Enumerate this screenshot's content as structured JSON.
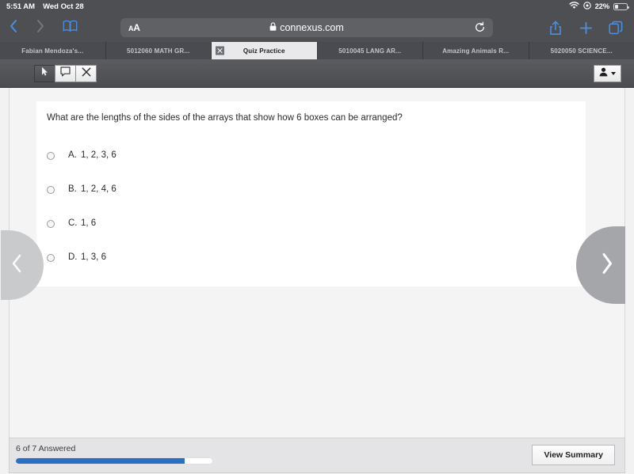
{
  "status_bar": {
    "time": "5:51 AM",
    "date": "Wed Oct 28",
    "wifi_icon": "wifi-icon",
    "location_icon": "location-services-icon",
    "battery_percent": "22%"
  },
  "browser": {
    "back_icon": "chevron-left-icon",
    "forward_icon": "chevron-right-icon",
    "bookmarks_icon": "book-icon",
    "text_size_label": "AA",
    "lock_icon": "lock-icon",
    "url": "connexus.com",
    "reload_icon": "reload-icon",
    "share_icon": "share-icon",
    "new_tab_icon": "plus-icon",
    "tabs_icon": "tabs-icon",
    "tabs": [
      {
        "label": "Fabian Mendoza's...",
        "active": false,
        "closable": false
      },
      {
        "label": "5012060 MATH GR...",
        "active": false,
        "closable": false
      },
      {
        "label": "Quiz Practice",
        "active": true,
        "closable": true,
        "close_icon": "close-icon"
      },
      {
        "label": "5010045 LANG AR...",
        "active": false,
        "closable": false
      },
      {
        "label": "Amazing Animals R...",
        "active": false,
        "closable": false
      },
      {
        "label": "5020050 SCIENCE...",
        "active": false,
        "closable": false
      }
    ]
  },
  "app_toolbar": {
    "tools": [
      {
        "icon": "pointer-icon",
        "selected": true
      },
      {
        "icon": "note-icon",
        "selected": false
      },
      {
        "icon": "close-icon",
        "selected": false
      }
    ],
    "user_menu": {
      "icon": "person-icon",
      "dropdown_icon": "caret-down-icon"
    }
  },
  "question": {
    "text": "What are the lengths of the sides of the arrays that show how 6 boxes can be arranged?",
    "options": [
      {
        "letter": "A.",
        "text": "1, 2, 3, 6",
        "selected": false
      },
      {
        "letter": "B.",
        "text": "1, 2, 4, 6",
        "selected": false
      },
      {
        "letter": "C.",
        "text": "1, 6",
        "selected": false
      },
      {
        "letter": "D.",
        "text": "1, 3, 6",
        "selected": false
      }
    ]
  },
  "navigation": {
    "prev_icon": "chevron-left-icon",
    "next_icon": "chevron-right-icon"
  },
  "footer": {
    "answered_label": "6 of 7 Answered",
    "progress_percent": 86,
    "progress_color": "#2b6fc4",
    "summary_button": "View Summary"
  }
}
